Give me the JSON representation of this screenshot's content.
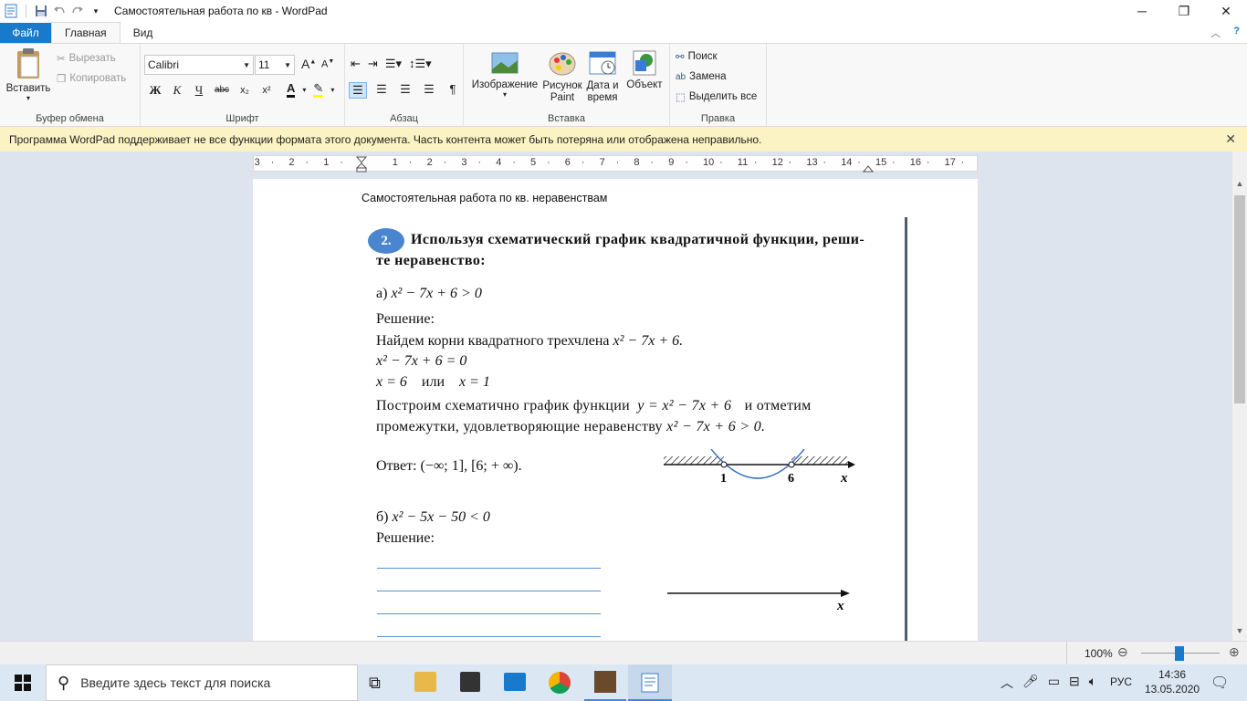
{
  "window": {
    "title": "Самостоятельная работа по кв - WordPad"
  },
  "menu": {
    "file": "Файл",
    "home": "Главная",
    "view": "Вид"
  },
  "ribbon": {
    "clipboard": {
      "paste": "Вставить",
      "cut": "Вырезать",
      "copy": "Копировать",
      "label": "Буфер обмена"
    },
    "font": {
      "name": "Calibri",
      "size": "11",
      "label": "Шрифт",
      "bold": "Ж",
      "italic": "К",
      "underline": "Ч",
      "strike": "abc",
      "sub": "x₂",
      "sup": "x²",
      "color": "A"
    },
    "paragraph": {
      "label": "Абзац"
    },
    "insert": {
      "image": "Изображение",
      "paint1": "Рисунок",
      "paint2": "Paint",
      "date1": "Дата и",
      "date2": "время",
      "object": "Объект",
      "label": "Вставка"
    },
    "edit": {
      "find": "Поиск",
      "replace": "Замена",
      "select_all": "Выделить все",
      "label": "Правка"
    }
  },
  "infobar": {
    "text": "Программа WordPad поддерживает не все функции формата этого документа. Часть контента может быть потеряна или отображена неправильно."
  },
  "ruler": {
    "ticks": [
      "3",
      "2",
      "1",
      "1",
      "2",
      "3",
      "4",
      "5",
      "6",
      "7",
      "8",
      "9",
      "10",
      "11",
      "12",
      "13",
      "14",
      "15",
      "16",
      "17"
    ]
  },
  "document": {
    "header": "Самостоятельная работа по кв. неравенствам",
    "badge": "2.",
    "task_line1": "Используя схематический график квадратичной функции, реши-",
    "task_line2": "те неравенство:",
    "part_a_label": "а)",
    "part_a_expr": "x² − 7x + 6 > 0",
    "solution": "Решение:",
    "step1_text": "Найдем корни квадратного трехчлена",
    "step1_expr": "x² − 7x + 6.",
    "equation": "x² − 7x + 6 = 0",
    "roots_a": "x = 6",
    "roots_or": "или",
    "roots_b": "x = 1",
    "plot_line1_a": "Построим схематично график функции",
    "plot_line1_expr": "y = x² − 7x + 6",
    "plot_line1_b": "и отметим",
    "plot_line2_a": "промежутки, удовлетворяющие неравенству",
    "plot_line2_expr": "x² − 7x + 6 > 0.",
    "answer": "Ответ: (−∞; 1], [6; + ∞).",
    "graph_root1": "1",
    "graph_root2": "6",
    "graph_axis": "x",
    "part_b_label": "б)",
    "part_b_expr": "x² − 5x − 50 < 0",
    "solution_b": "Решение:",
    "graph_b_axis": "x"
  },
  "status": {
    "zoom": "100%"
  },
  "taskbar": {
    "search_placeholder": "Введите здесь текст для поиска",
    "lang": "РУС",
    "time": "14:36",
    "date": "13.05.2020"
  },
  "colors": {
    "accent": "#1979ca",
    "infobar": "#fcf3c4",
    "badge": "#4a86d0",
    "curve": "#2a6ab8"
  }
}
